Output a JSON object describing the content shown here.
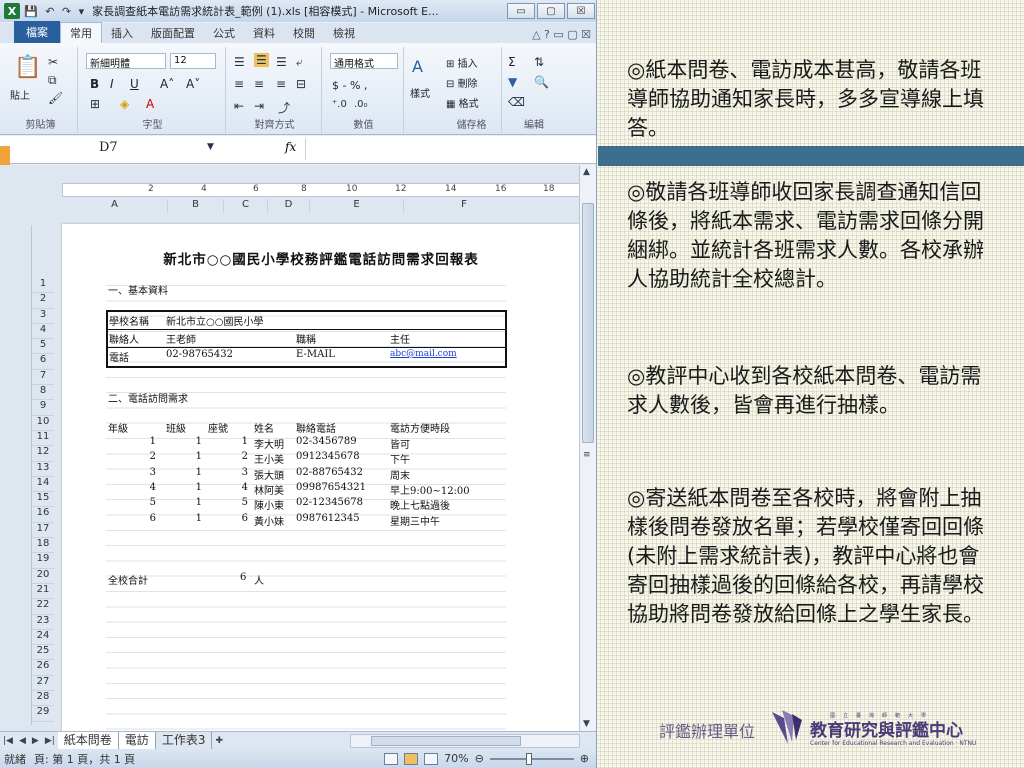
{
  "window": {
    "title": "家長調查紙本電訪需求統計表_範例 (1).xls [相容模式] - Microsoft E...",
    "app_icon": "X",
    "minimize": "▭",
    "restore": "▢",
    "close": "☒"
  },
  "ribbon_tabs": [
    "檔案",
    "常用",
    "插入",
    "版面配置",
    "公式",
    "資料",
    "校閱",
    "檢視"
  ],
  "ribbon": {
    "paste_label": "貼上",
    "font_name": "新細明體",
    "font_size": "12",
    "bold": "B",
    "italic": "I",
    "underline": "U",
    "grow_font": "A˄",
    "shrink_font": "A˅",
    "number_format": "通用格式",
    "currency": "$ - % ,",
    "style_label": "樣式",
    "insert": "插入",
    "delete": "刪除",
    "format": "格式",
    "sum": "Σ",
    "group_labels": [
      "剪貼簿",
      "字型",
      "對齊方式",
      "數值",
      "儲存格",
      "編輯"
    ]
  },
  "formula_bar": {
    "name_box": "D7",
    "fx": "fx",
    "value": ""
  },
  "ruler": [
    "2",
    "4",
    "6",
    "8",
    "10",
    "12",
    "14",
    "16",
    "18"
  ],
  "columns": [
    "A",
    "B",
    "C",
    "D",
    "E",
    "F"
  ],
  "rows": [
    "1",
    "2",
    "3",
    "4",
    "5",
    "6",
    "7",
    "8",
    "9",
    "10",
    "11",
    "12",
    "13",
    "14",
    "15",
    "16",
    "17",
    "18",
    "19",
    "20",
    "21",
    "22",
    "23",
    "24",
    "25",
    "26",
    "27",
    "28",
    "29"
  ],
  "sheet": {
    "title": "新北市○○國民小學校務評鑑電話訪問需求回報表",
    "section1": "一、基本資料",
    "school_label": "學校名稱",
    "school_value": "新北市立○○國民小學",
    "contact_label": "聯絡人",
    "contact_value": "王老師",
    "position_label": "職稱",
    "position_value": "主任",
    "phone_label": "電話",
    "phone_value": "02-98765432",
    "email_label": "E-MAIL",
    "email_value": "abc@mail.com",
    "section2": "二、電話訪問需求",
    "headers": [
      "年級",
      "班級",
      "座號",
      "姓名",
      "聯絡電話",
      "電訪方便時段"
    ],
    "records": [
      [
        "1",
        "1",
        "1",
        "李大明",
        "02-3456789",
        "皆可"
      ],
      [
        "2",
        "1",
        "2",
        "王小美",
        "0912345678",
        "下午"
      ],
      [
        "3",
        "1",
        "3",
        "張大頭",
        "02-88765432",
        "周末"
      ],
      [
        "4",
        "1",
        "4",
        "林阿美",
        "09987654321",
        "早上9:00~12:00"
      ],
      [
        "5",
        "1",
        "5",
        "陳小東",
        "02-12345678",
        "晚上七點過後"
      ],
      [
        "6",
        "1",
        "6",
        "黃小妹",
        "0987612345",
        "星期三中午"
      ]
    ],
    "total_label": "全校合計",
    "total_value": "6",
    "total_unit": "人"
  },
  "sheet_tabs": [
    "紙本問卷",
    "電訪",
    "工作表3"
  ],
  "status": {
    "ready": "就緒",
    "page": "頁: 第 1 頁，共 1 頁",
    "zoom": "70%",
    "zoom_fraction": 0.7
  },
  "panel": {
    "paragraphs": [
      "◎紙本問卷、電訪成本甚高，敬請各班導師協助通知家長時，多多宣導線上填答。",
      "◎敬請各班導師收回家長調查通知信回條後，將紙本需求、電訪需求回條分開綑綁。並統計各班需求人數。各校承辦人協助統計全校總計。",
      "◎教評中心收到各校紙本問卷、電訪需求人數後，皆會再進行抽樣。",
      "◎寄送紙本問卷至各校時，將會附上抽樣後問卷發放名單；若學校僅寄回回條(未附上需求統計表)，教評中心將也會寄回抽樣過後的回條給各校，再請學校協助將問卷發放給回條上之學生家長。"
    ],
    "footer_label": "評鑑辦理單位",
    "logo_name": "教育研究與評鑑中心",
    "logo_english": "Center for Educational Research and Evaluation · NTNU",
    "logo_small": "國立臺灣師範大學"
  },
  "colors": {
    "accent_bar": "#3d6e8f",
    "excel_green": "#1f7a3a",
    "file_tab": "#2a5f9e"
  }
}
